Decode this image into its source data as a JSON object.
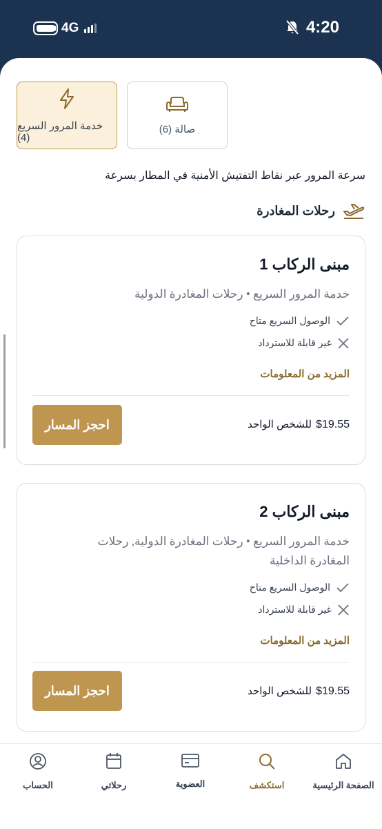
{
  "status_bar": {
    "network": "4G",
    "time": "4:20"
  },
  "tabs": [
    {
      "label": "خدمة المرور السريع (4)",
      "icon": "lightning-icon",
      "active": true
    },
    {
      "label": "صالة (6)",
      "icon": "armchair-icon",
      "active": false
    }
  ],
  "description": "سرعة المرور عبر نقاط التفتيش الأمنية في المطار بسرعة",
  "section": {
    "title": "رحلات المغادرة",
    "icon": "plane-departure-icon"
  },
  "cards": [
    {
      "title": "مبنى الركاب 1",
      "subtitle": "خدمة المرور السريع  •  رحلات المغادرة الدولية",
      "features": [
        {
          "text": "الوصول السريع متاح",
          "icon": "check-icon"
        },
        {
          "text": "غير قابلة للاسترداد",
          "icon": "x-icon"
        }
      ],
      "more_label": "المزيد من المعلومات",
      "price": "$19.55",
      "price_unit": "للشخص الواحد",
      "book_label": "احجز المسار"
    },
    {
      "title": "مبنى الركاب 2",
      "subtitle": "خدمة المرور السريع  •  رحلات المغادرة الدولية, رحلات المغادرة الداخلية",
      "features": [
        {
          "text": "الوصول السريع متاح",
          "icon": "check-icon"
        },
        {
          "text": "غير قابلة للاسترداد",
          "icon": "x-icon"
        }
      ],
      "more_label": "المزيد من المعلومات",
      "price": "$19.55",
      "price_unit": "للشخص الواحد",
      "book_label": "احجز المسار"
    }
  ],
  "bottom_nav": [
    {
      "label": "الصفحة الرئيسية",
      "icon": "home-icon"
    },
    {
      "label": "استكشف",
      "icon": "search-icon",
      "active": true
    },
    {
      "label": "العضوية",
      "icon": "card-icon"
    },
    {
      "label": "رحلاتي",
      "icon": "calendar-icon"
    },
    {
      "label": "الحساب",
      "icon": "user-icon"
    }
  ],
  "colors": {
    "header": "#1b3350",
    "accent": "#bf9650",
    "accent_text": "#8a6a2e",
    "active_tab_bg": "#faf0dc"
  }
}
